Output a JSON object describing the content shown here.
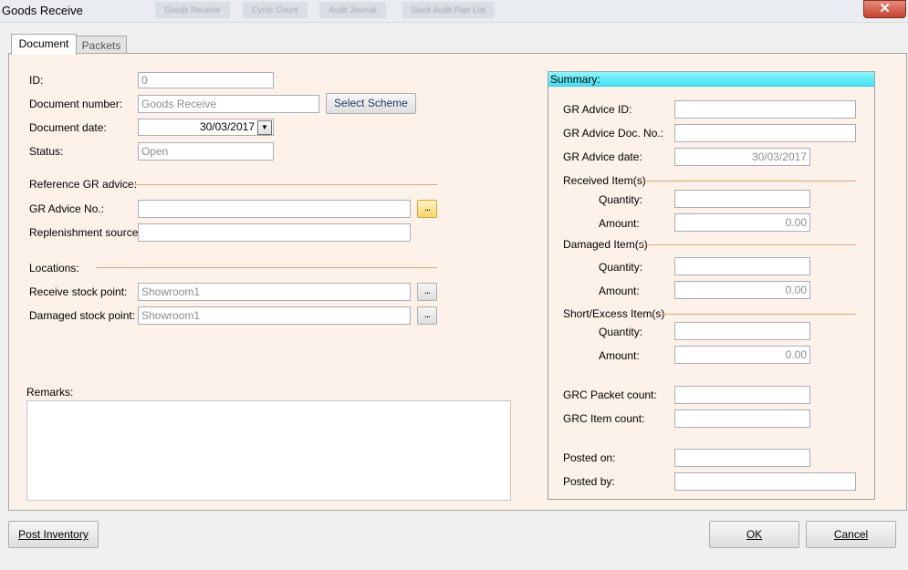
{
  "window": {
    "title": "Goods Receive",
    "background_tabs": [
      "Goods Receive",
      "Cyclic Count",
      "Audit Journal",
      "Stock Audit Plan List"
    ],
    "close_glyph": "✕"
  },
  "tabs": [
    {
      "label": "Document",
      "selected": true
    },
    {
      "label": "Packets",
      "selected": false
    }
  ],
  "document": {
    "id": {
      "label": "ID:",
      "value": "0"
    },
    "document_number": {
      "label": "Document number:",
      "value": "Goods Receive"
    },
    "select_scheme_button": "Select Scheme",
    "document_date": {
      "label": "Document date:",
      "value": "30/03/2017"
    },
    "status": {
      "label": "Status:",
      "value": "Open"
    },
    "reference_section": "Reference GR advice:",
    "gr_advice_no": {
      "label": "GR Advice No.:",
      "value": ""
    },
    "replenishment_source": {
      "label": "Replenishment source:",
      "value": ""
    },
    "locations_section": "Locations:",
    "receive_stock_point": {
      "label": "Receive stock point:",
      "value": "Showroom1"
    },
    "damaged_stock_point": {
      "label": "Damaged stock point:",
      "value": "Showroom1"
    },
    "browse_button": "...",
    "remarks": {
      "label": "Remarks:",
      "value": ""
    }
  },
  "summary": {
    "title": "Summary:",
    "gr_advice_id": {
      "label": "GR Advice ID:",
      "value": ""
    },
    "gr_advice_doc_no": {
      "label": "GR Advice Doc. No.:",
      "value": ""
    },
    "gr_advice_date": {
      "label": "GR Advice date:",
      "value": "30/03/2017"
    },
    "received": {
      "section": "Received Item(s)",
      "quantity_label": "Quantity:",
      "quantity": "",
      "amount_label": "Amount:",
      "amount": "0.00"
    },
    "damaged": {
      "section": "Damaged Item(s)",
      "quantity_label": "Quantity:",
      "quantity": "",
      "amount_label": "Amount:",
      "amount": "0.00"
    },
    "short_excess": {
      "section": "Short/Excess Item(s)",
      "quantity_label": "Quantity:",
      "quantity": "",
      "amount_label": "Amount:",
      "amount": "0.00"
    },
    "grc_packet_count": {
      "label": "GRC Packet count:",
      "value": ""
    },
    "grc_item_count": {
      "label": "GRC Item count:",
      "value": ""
    },
    "posted_on": {
      "label": "Posted on:",
      "value": ""
    },
    "posted_by": {
      "label": "Posted by:",
      "value": ""
    }
  },
  "footer": {
    "post_inventory": "Post Inventory",
    "ok": "OK",
    "cancel": "Cancel"
  },
  "colors": {
    "panel_background": "#fcf2e9",
    "summary_header": "#3fe2f5",
    "separator": "#e2a576",
    "close_button": "#c8412e"
  }
}
